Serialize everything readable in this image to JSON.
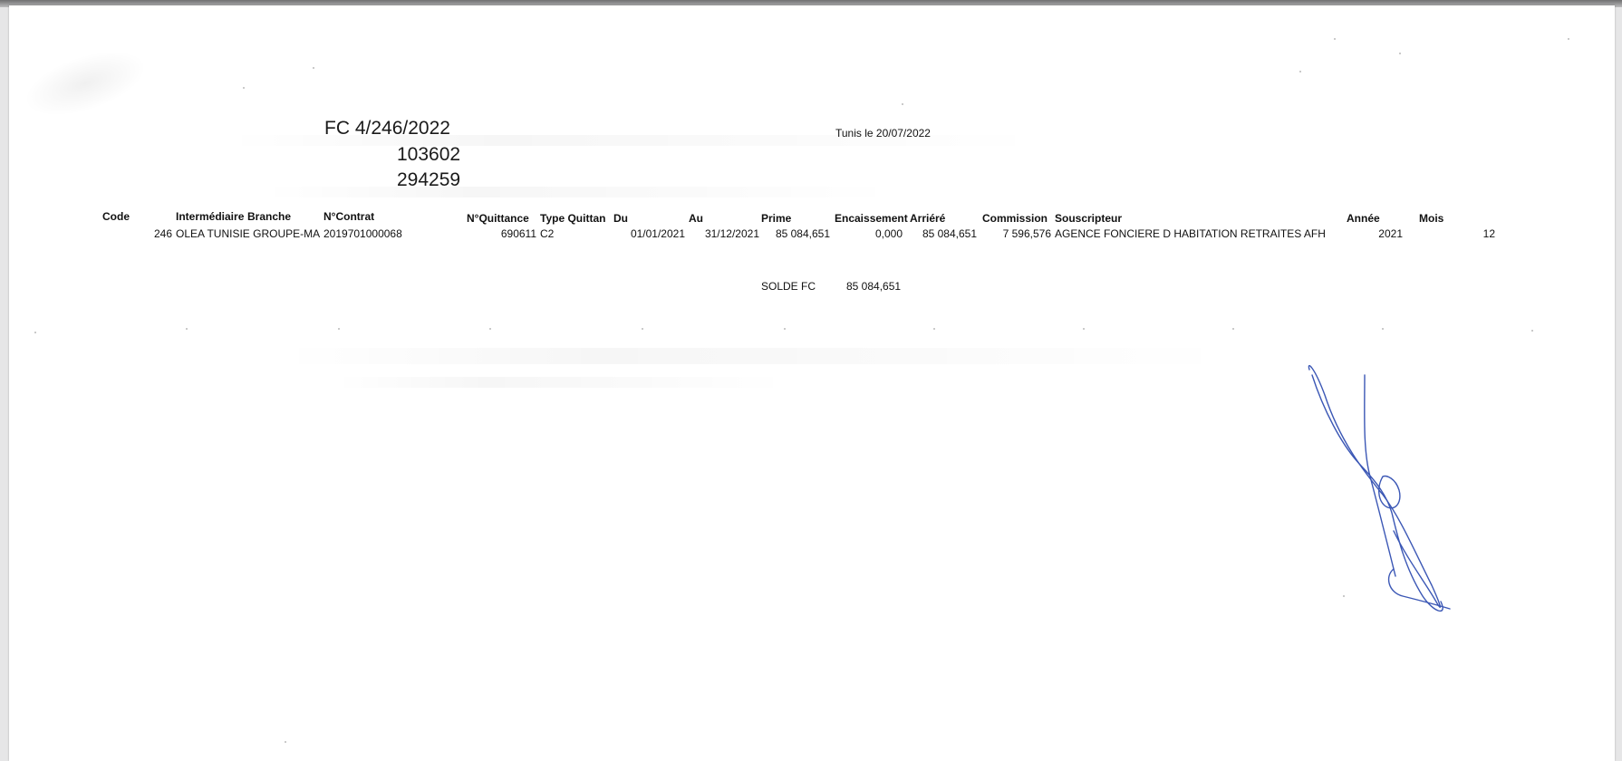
{
  "document": {
    "references": [
      "FC 4/246/2022",
      "103602",
      "294259"
    ],
    "date_line": "Tunis le 20/07/2022"
  },
  "table": {
    "headers": {
      "code": "Code",
      "intermediaire": "Intermédiaire",
      "branche": "Branche",
      "contrat": "N°Contrat",
      "quittance": "N°Quittance",
      "type_quittance": "Type Quittan",
      "du": "Du",
      "au": "Au",
      "prime": "Prime",
      "encaissement": "Encaissement",
      "arriere": "Arriéré",
      "commission": "Commission",
      "souscripteur": "Souscripteur",
      "annee": "Année",
      "mois": "Mois"
    },
    "row": {
      "code": "246",
      "intermediaire": "OLEA TUNISIE GROUPE-MAI",
      "contrat": "2019701000068",
      "quittance": "690611",
      "type_quittance": "C2",
      "du": "01/01/2021",
      "au": "31/12/2021",
      "prime": "85 084,651",
      "encaissement": "0,000",
      "arriere": "85 084,651",
      "commission": "7 596,576",
      "souscripteur": "AGENCE FONCIERE D  HABITATION RETRAITES AFH",
      "annee": "2021",
      "mois": "12"
    }
  },
  "summary": {
    "label": "SOLDE FC",
    "value": "85 084,651"
  },
  "signature": {
    "ink_color": "#3b57b5"
  }
}
